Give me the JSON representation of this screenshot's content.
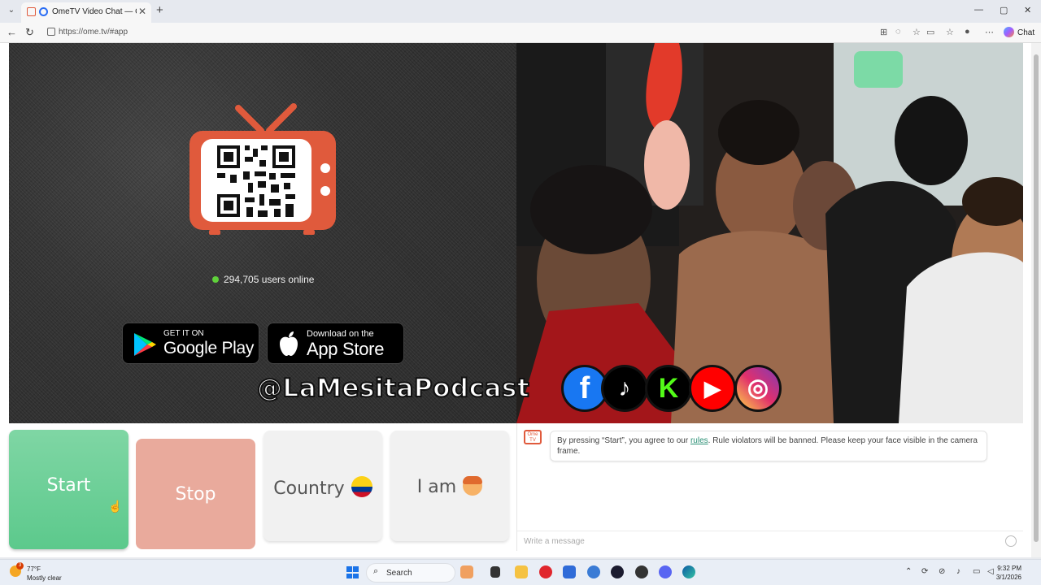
{
  "browser": {
    "tab_title": "OmeTV Video Chat — Omegle",
    "new_tab": "+",
    "url": "https://ome.tv/#app",
    "chat_label": "Chat",
    "window_controls": {
      "minimize": "—",
      "restore": "▢",
      "close": "✕"
    }
  },
  "left_panel": {
    "users_online": "294,705 users online",
    "google_play": {
      "small": "GET IT ON",
      "big": "Google Play"
    },
    "app_store": {
      "small": "Download on the",
      "big": "App Store"
    }
  },
  "overlay": {
    "handle": "@LaMesitaPodcast",
    "socials": [
      {
        "icon": "facebook-icon",
        "glyph": "f",
        "color": "#1877f2"
      },
      {
        "icon": "tiktok-icon",
        "glyph": "♪",
        "color": "#000000"
      },
      {
        "icon": "kick-icon",
        "glyph": "K",
        "color": "#000000"
      },
      {
        "icon": "youtube-icon",
        "glyph": "▶",
        "color": "#ff0000"
      },
      {
        "icon": "instagram-icon",
        "glyph": "◎",
        "color": "#d6249f"
      }
    ]
  },
  "controls": {
    "start": "Start",
    "stop": "Stop",
    "country": "Country",
    "iam": "I am"
  },
  "chat": {
    "logo": "Ome TV",
    "notice_before": "By pressing “Start”, you agree to our ",
    "notice_link": "rules",
    "notice_after": ". Rule violators will be banned. Please keep your face visible in the camera frame.",
    "placeholder": "Write a message"
  },
  "taskbar": {
    "weather_temp": "77°F",
    "weather_desc": "Mostly clear",
    "weather_badge": "3",
    "search": "Search",
    "time": "9:32 PM",
    "date": "3/1/2026"
  },
  "colors": {
    "start_green": "#6fd09a",
    "stop_salmon": "#e9aa9c",
    "brand_red": "#e05a3c",
    "online_green": "#5fd13a"
  }
}
